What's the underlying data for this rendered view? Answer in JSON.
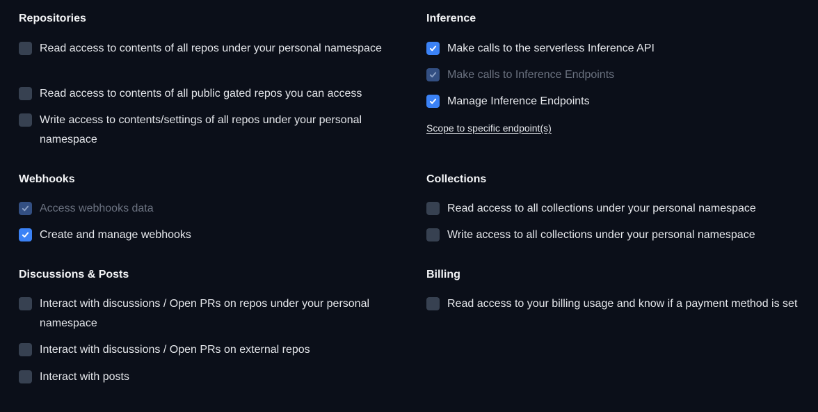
{
  "left": {
    "repositories": {
      "title": "Repositories",
      "items": [
        {
          "label": "Read access to contents of all repos under your personal namespace",
          "checked": false,
          "disabled": false
        },
        {
          "label": "Read access to contents of all public gated repos you can access",
          "checked": false,
          "disabled": false
        },
        {
          "label": "Write access to contents/settings of all repos under your personal namespace",
          "checked": false,
          "disabled": false
        }
      ]
    },
    "webhooks": {
      "title": "Webhooks",
      "items": [
        {
          "label": "Access webhooks data",
          "checked": true,
          "disabled": true
        },
        {
          "label": "Create and manage webhooks",
          "checked": true,
          "disabled": false
        }
      ]
    },
    "discussions": {
      "title": "Discussions & Posts",
      "items": [
        {
          "label": "Interact with discussions / Open PRs on repos under your personal namespace",
          "checked": false,
          "disabled": false
        },
        {
          "label": "Interact with discussions / Open PRs on external repos",
          "checked": false,
          "disabled": false
        },
        {
          "label": "Interact with posts",
          "checked": false,
          "disabled": false
        }
      ]
    }
  },
  "right": {
    "inference": {
      "title": "Inference",
      "items": [
        {
          "label": "Make calls to the serverless Inference API",
          "checked": true,
          "disabled": false
        },
        {
          "label": "Make calls to Inference Endpoints",
          "checked": true,
          "disabled": true
        },
        {
          "label": "Manage Inference Endpoints",
          "checked": true,
          "disabled": false
        }
      ],
      "scope_link": "Scope to specific endpoint(s)"
    },
    "collections": {
      "title": "Collections",
      "items": [
        {
          "label": "Read access to all collections under your personal namespace",
          "checked": false,
          "disabled": false
        },
        {
          "label": "Write access to all collections under your personal namespace",
          "checked": false,
          "disabled": false
        }
      ]
    },
    "billing": {
      "title": "Billing",
      "items": [
        {
          "label": "Read access to your billing usage and know if a payment method is set",
          "checked": false,
          "disabled": false
        }
      ]
    }
  },
  "colors": {
    "background": "#0b0f19",
    "checkbox_checked": "#3b82f6",
    "checkbox_unchecked": "#374151",
    "checkbox_checked_disabled": "#334f82",
    "text": "#e5e7eb",
    "text_disabled": "#6b7280"
  }
}
